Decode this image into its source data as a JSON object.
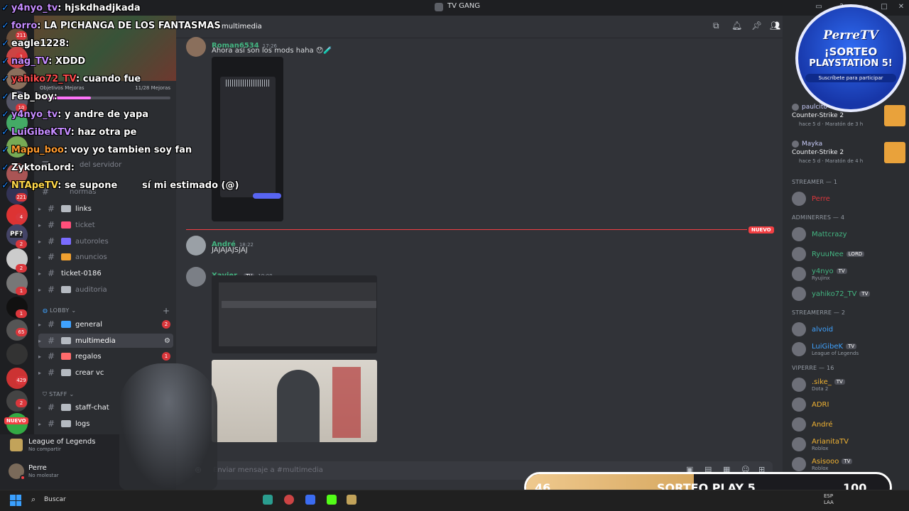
{
  "window": {
    "title": "TV GANG"
  },
  "stream_chat": [
    {
      "user": "y4nyo_tv",
      "color": "#c58cff",
      "text": "hjskdhadjkada"
    },
    {
      "user": "forro",
      "color": "#c58cff",
      "text": "LA PICHANGA DE LOS FANTASMAS"
    },
    {
      "user": "eagle1228",
      "color": "#ffffff",
      "text": ""
    },
    {
      "user": "nag_TV",
      "color": "#c58cff",
      "text": "XDDD"
    },
    {
      "user": "yahiko72_TV",
      "color": "#ff4d4d",
      "text": "cuando fue"
    },
    {
      "user": "Feb_boy",
      "color": "#ffffff",
      "text": ""
    },
    {
      "user": "y4nyo_tv",
      "color": "#c58cff",
      "text": "y andre de yapa"
    },
    {
      "user": "LuiGibeKTV",
      "color": "#c58cff",
      "text": "haz otra pe"
    },
    {
      "user": "Mapu_boo",
      "color": "#ff9a2e",
      "text": "voy yo tambien soy fan"
    },
    {
      "user": "ZyktonLord",
      "color": "#ffffff",
      "text": ""
    },
    {
      "user": "NTApeTV",
      "color": "#ffd84a",
      "text": "se supone"
    },
    {
      "user": "",
      "color": "#ffffff",
      "text": "sí mi estimado (@)"
    }
  ],
  "channel_header": {
    "name": "multimedia"
  },
  "channels": {
    "top_labels": {
      "objetivos": "Objetivos Mejoras",
      "mejoras": "11/28 Mejoras",
      "del_servidor": "del servidor",
      "normas": "normas"
    },
    "items": [
      {
        "name": "links",
        "emoji_color": "#b5bac1",
        "bright": true
      },
      {
        "name": "ticket",
        "emoji_color": "#ff4f7a",
        "bright": false
      },
      {
        "name": "autoroles",
        "emoji_color": "#7a6cff",
        "bright": false
      },
      {
        "name": "anuncios",
        "emoji_color": "#f0a030",
        "bright": false
      },
      {
        "name": "ticket-0186",
        "emoji_color": "",
        "bright": true
      },
      {
        "name": "auditoria",
        "emoji_color": "#b5bac1",
        "bright": false
      }
    ],
    "lobby_label": "LOBBY",
    "lobby": [
      {
        "name": "general",
        "badge": "2",
        "emoji_color": "#3fa2ff"
      },
      {
        "name": "multimedia",
        "badge": "",
        "emoji_color": "#b5bac1"
      },
      {
        "name": "regalos",
        "badge": "1",
        "emoji_color": "#ff6b6b"
      },
      {
        "name": "crear vc",
        "badge": "",
        "emoji_color": "#b5bac1"
      }
    ],
    "staff_label": "STAFF",
    "staff": [
      {
        "name": "staff-chat",
        "emoji_color": "#b5bac1"
      },
      {
        "name": "logs",
        "emoji_color": "#b5bac1"
      }
    ]
  },
  "activity": {
    "game": "League of Legends",
    "status": "No compartir"
  },
  "user": {
    "name": "Perre",
    "status": "No molestar"
  },
  "server_rail": {
    "badges": [
      "211",
      "1",
      "10",
      "221",
      "4",
      "2",
      "2",
      "1",
      "1",
      "65",
      "429",
      "2"
    ],
    "labels": {
      "pf": "PF?",
      "nuevo": "NUEVO"
    }
  },
  "messages": [
    {
      "author": "Roman6534",
      "author_color": "#43b581",
      "time": "17:26",
      "text": "Ahora así son los mods haha 😯🧪"
    },
    {
      "author": "André",
      "author_color": "#43b581",
      "time": "18:22",
      "text": "JAJAJAJSJAJ"
    },
    {
      "author": "Xavier",
      "author_color": "#43b581",
      "tag": "TV",
      "time": "19:08",
      "text": ""
    }
  ],
  "new_divider": "NUEVO",
  "composer": {
    "placeholder": "Enviar mensaje a #multimedia"
  },
  "members": {
    "activity": [
      {
        "name": "paulcito",
        "game": "Counter-Strike 2",
        "detail": "hace 5 d  ·  Maratón de 3 h"
      },
      {
        "name": "Mayka",
        "game": "Counter-Strike 2",
        "detail": "hace 5 d  ·  Maratón de 4 h"
      }
    ],
    "groups": [
      {
        "label": "STREAMER — 1",
        "members": [
          {
            "name": "Perre",
            "color": "#da373c",
            "tag": "",
            "sub": ""
          }
        ]
      },
      {
        "label": "ADMINERRES — 4",
        "members": [
          {
            "name": "Mattcrazy",
            "color": "#43b581",
            "tag": "",
            "sub": ""
          },
          {
            "name": "RyuuNee",
            "color": "#43b581",
            "tag": "LORD",
            "sub": ""
          },
          {
            "name": "y4nyo",
            "color": "#43b581",
            "tag": "TV",
            "sub": "Ryujinx"
          },
          {
            "name": "yahiko72_TV",
            "color": "#43b581",
            "tag": "TV",
            "sub": ""
          }
        ]
      },
      {
        "label": "STREAMERRE — 2",
        "members": [
          {
            "name": "alvoid",
            "color": "#3fa2ff",
            "tag": "",
            "sub": ""
          },
          {
            "name": "LuiGibeK",
            "color": "#3fa2ff",
            "tag": "TV",
            "sub": "League of Legends"
          }
        ]
      },
      {
        "label": "VIPERRE — 16",
        "members": [
          {
            "name": ".sike_",
            "color": "#f0b232",
            "tag": "TV",
            "sub": "Dota 2"
          },
          {
            "name": "ADRI",
            "color": "#f0b232",
            "tag": "",
            "sub": ""
          },
          {
            "name": "André",
            "color": "#f0b232",
            "tag": "",
            "sub": ""
          },
          {
            "name": "ArianitaTV",
            "color": "#f0b232",
            "tag": "",
            "sub": "Roblox"
          },
          {
            "name": "Asisooo",
            "color": "#f0b232",
            "tag": "TV",
            "sub": "Roblox"
          }
        ]
      }
    ]
  },
  "giveaway_badge": {
    "brand": "PerreTV",
    "title1": "¡SORTEO",
    "title2": "PLAYSTATION 5!",
    "sub": "Suscríbete para participar"
  },
  "progress": {
    "current": "46",
    "label": "SORTEO PLAY 5",
    "goal": "100",
    "fraction": 0.46
  },
  "taskbar": {
    "search": "Buscar",
    "lang1": "ESP",
    "lang2": "LAA"
  },
  "colors": {
    "accent": "#5865f2",
    "danger": "#da373c",
    "online": "#23a55a"
  }
}
